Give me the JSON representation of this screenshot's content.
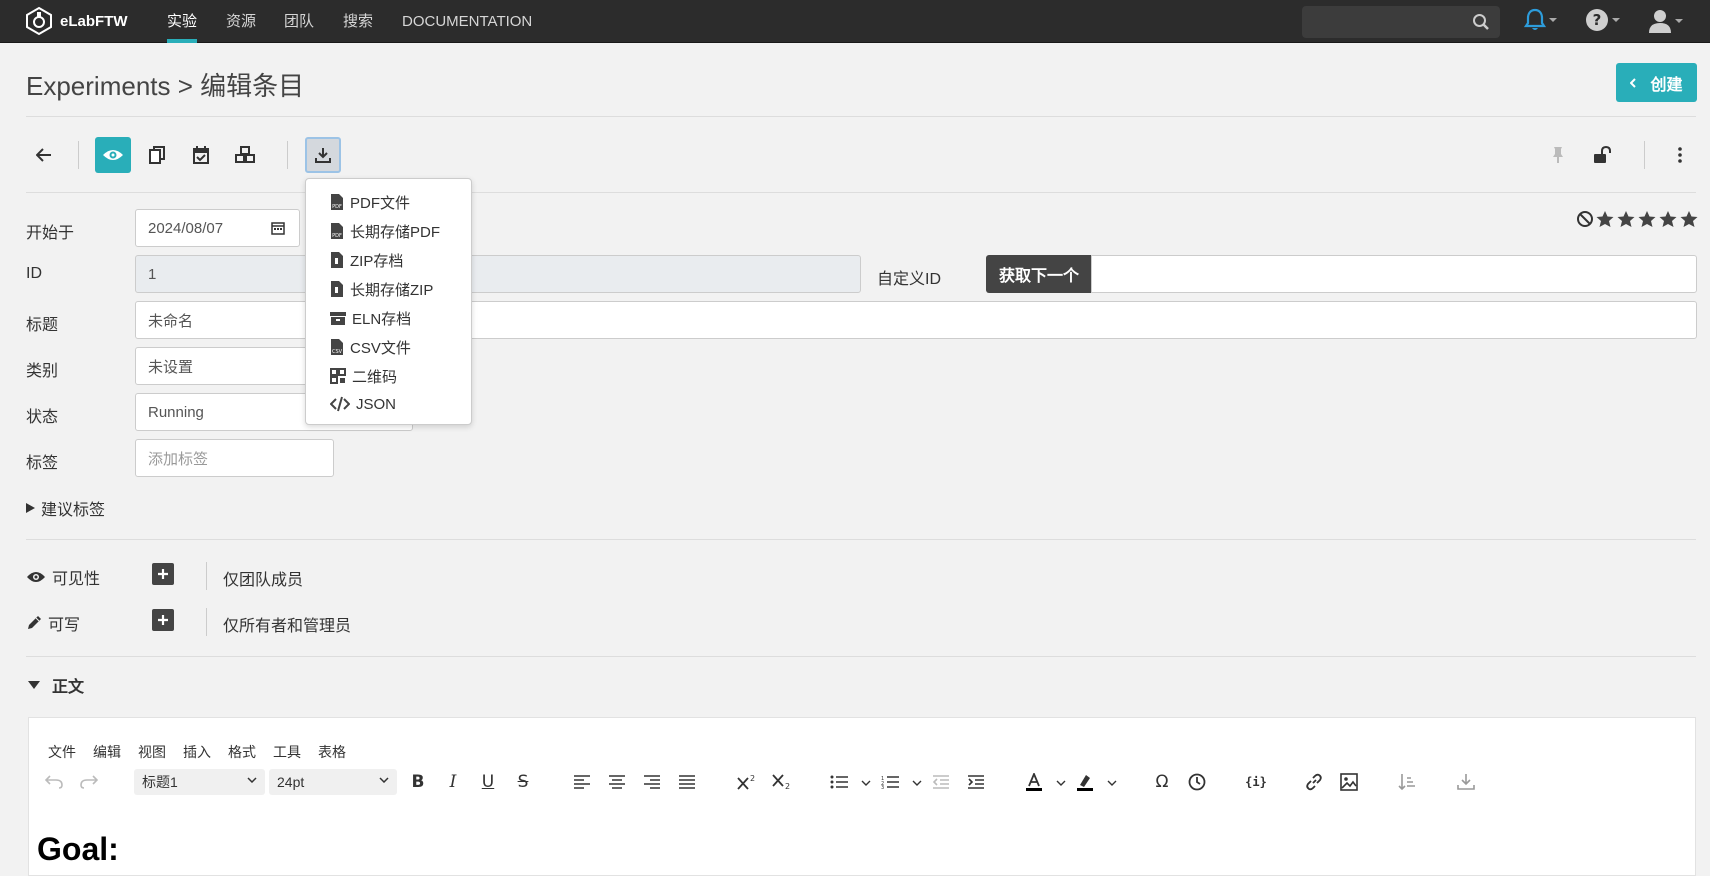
{
  "nav": {
    "brand": "eLabFTW",
    "links": [
      "实验",
      "资源",
      "团队",
      "搜索",
      "DOCUMENTATION"
    ],
    "search_placeholder": ""
  },
  "header": {
    "breadcrumb": "Experiments > 编辑条目",
    "create_label": "创建"
  },
  "export_menu": {
    "items": [
      "PDF文件",
      "长期存储PDF",
      "ZIP存档",
      "长期存储ZIP",
      "ELN存档",
      "CSV文件",
      "二维码",
      "JSON"
    ]
  },
  "form": {
    "start_label": "开始于",
    "start_value": "2024/08/07",
    "id_label": "ID",
    "id_value": "1",
    "custom_id_label": "自定义ID",
    "next_label": "获取下一个",
    "title_label": "标题",
    "title_value": "未命名",
    "category_label": "类别",
    "category_value": "未设置",
    "status_label": "状态",
    "status_value": "Running",
    "tags_label": "标签",
    "tags_placeholder": "添加标签",
    "suggest_tags": "建议标签"
  },
  "permissions": {
    "visibility_label": "可见性",
    "visibility_value": "仅团队成员",
    "write_label": "可写",
    "write_value": "仅所有者和管理员"
  },
  "body": {
    "section_label": "正文",
    "menus": [
      "文件",
      "编辑",
      "视图",
      "插入",
      "格式",
      "工具",
      "表格"
    ],
    "block_format": "标题1",
    "font_size": "24pt",
    "content_heading": "Goal:"
  },
  "colors": {
    "accent": "#29aeb9",
    "navbar": "#2c2c2c",
    "bell": "#2d9cdb"
  }
}
